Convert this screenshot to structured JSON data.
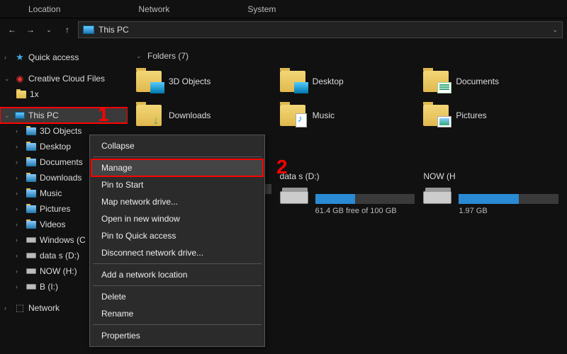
{
  "tabs": [
    "Location",
    "Network",
    "System"
  ],
  "address": "This PC",
  "sidebar": {
    "quick": "Quick access",
    "cc": "Creative Cloud Files",
    "onex": "1x",
    "thispc": "This PC",
    "items": [
      "3D Objects",
      "Desktop",
      "Documents",
      "Downloads",
      "Music",
      "Pictures",
      "Videos",
      "Windows (C",
      "data s (D:)",
      "NOW (H:)",
      "B (I:)"
    ],
    "net": "Network"
  },
  "folders_header": "Folders (7)",
  "folders": [
    {
      "label": "3D Objects",
      "ov": "blue"
    },
    {
      "label": "Desktop",
      "ov": "blue"
    },
    {
      "label": "Documents",
      "ov": "doc"
    },
    {
      "label": "Downloads",
      "ov": "dl"
    },
    {
      "label": "Music",
      "ov": "note"
    },
    {
      "label": "Pictures",
      "ov": "pic"
    }
  ],
  "drives": [
    {
      "label": "",
      "sub": "",
      "fill": 55
    },
    {
      "label": "data s (D:)",
      "sub": "61.4 GB free of 100 GB",
      "fill": 40
    },
    {
      "label": "NOW (H",
      "sub": "1.97 GB",
      "fill": 60
    }
  ],
  "ctx": {
    "collapse": "Collapse",
    "manage": "Manage",
    "pin": "Pin to Start",
    "map": "Map network drive...",
    "open": "Open in new window",
    "pinq": "Pin to Quick access",
    "disc": "Disconnect network drive...",
    "addnet": "Add a network location",
    "del": "Delete",
    "ren": "Rename",
    "prop": "Properties"
  },
  "anno": {
    "one": "1",
    "two": "2"
  }
}
